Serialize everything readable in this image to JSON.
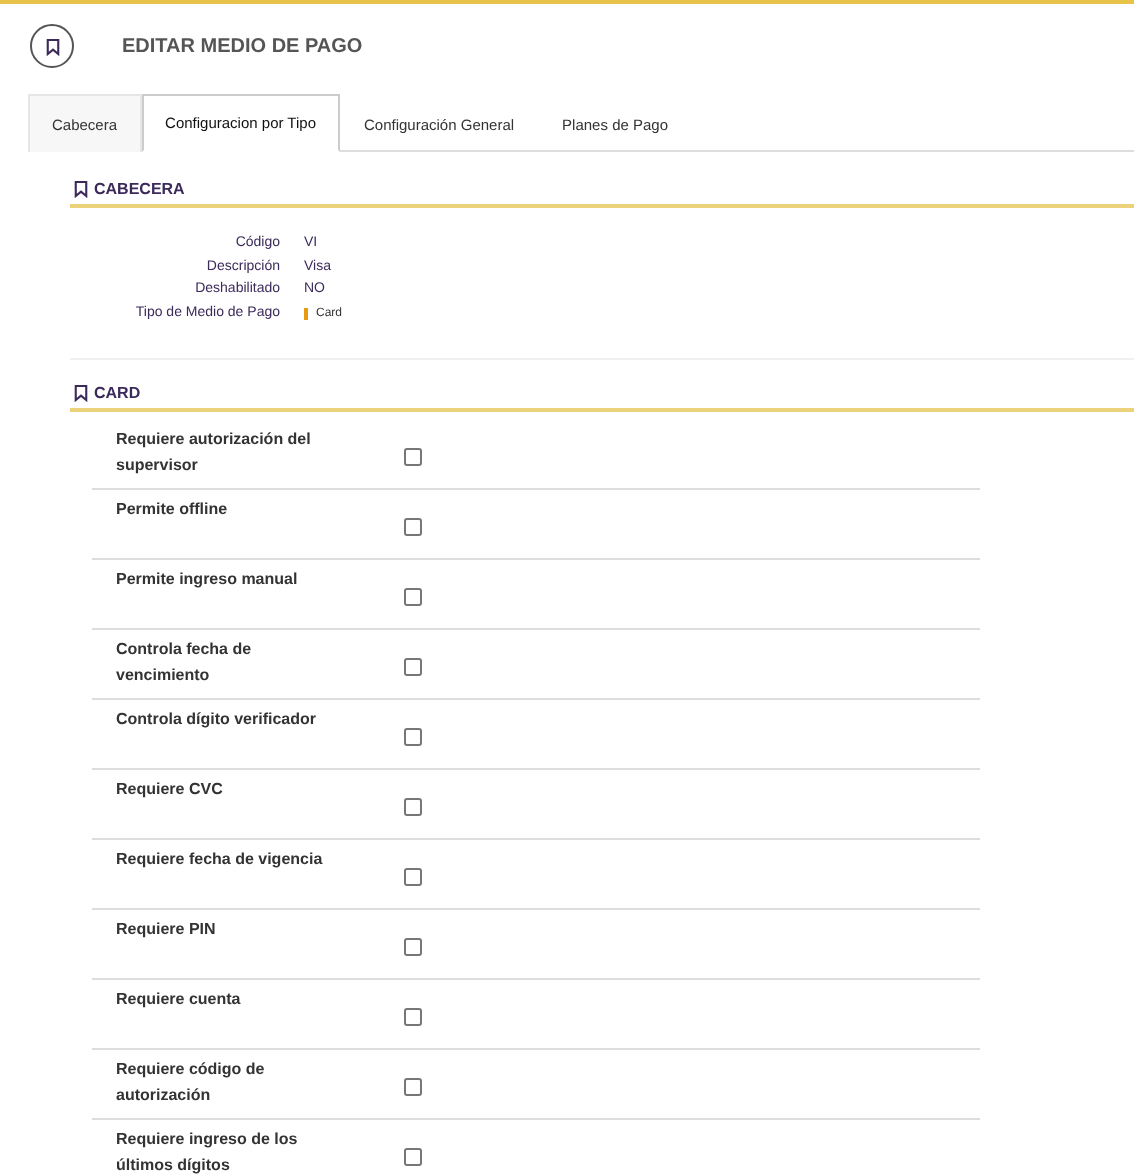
{
  "header": {
    "title": "EDITAR MEDIO DE PAGO"
  },
  "tabs": [
    {
      "label": "Cabecera",
      "selected": false
    },
    {
      "label": "Configuracion por Tipo",
      "selected": true
    },
    {
      "label": "Configuración General",
      "selected": false
    },
    {
      "label": "Planes de Pago",
      "selected": false
    }
  ],
  "cabecera": {
    "title": "CABECERA",
    "fields": [
      {
        "label": "Código",
        "value": "VI",
        "kind": "text"
      },
      {
        "label": "Descripción",
        "value": "Visa",
        "kind": "text"
      },
      {
        "label": "Deshabilitado",
        "value": "NO",
        "kind": "text"
      },
      {
        "label": "Tipo de Medio de Pago",
        "value": "Card",
        "kind": "tag"
      }
    ]
  },
  "card": {
    "title": "CARD",
    "options": [
      {
        "label": "Requiere autorización del supervisor",
        "checked": false
      },
      {
        "label": "Permite offline",
        "checked": false
      },
      {
        "label": "Permite ingreso manual",
        "checked": false
      },
      {
        "label": "Controla fecha de vencimiento",
        "checked": false
      },
      {
        "label": "Controla dígito verificador",
        "checked": false
      },
      {
        "label": "Requiere CVC",
        "checked": false
      },
      {
        "label": "Requiere fecha de vigencia",
        "checked": false
      },
      {
        "label": "Requiere PIN",
        "checked": false
      },
      {
        "label": "Requiere cuenta",
        "checked": false
      },
      {
        "label": "Requiere código de autorización",
        "checked": false
      },
      {
        "label": "Requiere ingreso de los últimos dígitos",
        "checked": false
      }
    ]
  }
}
